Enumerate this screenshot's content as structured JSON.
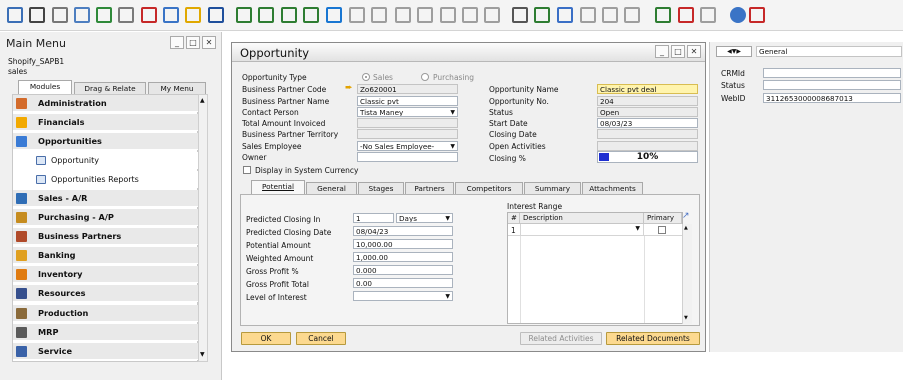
{
  "toolbar": {
    "icons": [
      "search-icon",
      "print-icon",
      "email-icon",
      "fax-icon",
      "excel-icon",
      "word-icon",
      "pdf-icon",
      "launch-icon",
      "lock-icon",
      "binoculars-icon",
      "first-record-icon",
      "previous-record-icon",
      "next-record-icon",
      "last-record-icon",
      "refresh-icon",
      "filter-icon",
      "sort-icon",
      "base-document-icon",
      "target-document-icon",
      "gross-profit-icon",
      "tree-icon",
      "layout-icon",
      "pen-icon",
      "edit-icon",
      "approve-icon",
      "message-icon",
      "chat-icon",
      "settings-icon",
      "calendar-icon",
      "cockpit-icon",
      "org-icon",
      "help-icon",
      "exit-icon"
    ]
  },
  "main_menu": {
    "title": "Main Menu",
    "company": "Shopify_SAPB1",
    "user": "sales",
    "tabs": [
      "Modules",
      "Drag & Relate",
      "My Menu"
    ],
    "items": [
      {
        "label": "Administration",
        "sub": false,
        "icon": "administration-icon"
      },
      {
        "label": "Financials",
        "sub": false,
        "icon": "financials-icon"
      },
      {
        "label": "Opportunities",
        "sub": false,
        "icon": "opportunities-icon"
      },
      {
        "label": "Opportunity",
        "sub": true,
        "icon": "folder-icon"
      },
      {
        "label": "Opportunities Reports",
        "sub": true,
        "icon": "folder-icon"
      },
      {
        "label": "Sales - A/R",
        "sub": false,
        "icon": "sales-icon"
      },
      {
        "label": "Purchasing - A/P",
        "sub": false,
        "icon": "purchasing-icon"
      },
      {
        "label": "Business Partners",
        "sub": false,
        "icon": "business-partners-icon"
      },
      {
        "label": "Banking",
        "sub": false,
        "icon": "banking-icon"
      },
      {
        "label": "Inventory",
        "sub": false,
        "icon": "inventory-icon"
      },
      {
        "label": "Resources",
        "sub": false,
        "icon": "resources-icon"
      },
      {
        "label": "Production",
        "sub": false,
        "icon": "production-icon"
      },
      {
        "label": "MRP",
        "sub": false,
        "icon": "mrp-icon"
      },
      {
        "label": "Service",
        "sub": false,
        "icon": "service-icon"
      }
    ]
  },
  "opportunity": {
    "title": "Opportunity",
    "left_labels": {
      "type": "Opportunity Type",
      "bp_code": "Business Partner Code",
      "bp_name": "Business Partner Name",
      "contact": "Contact Person",
      "total": "Total Amount Invoiced",
      "territory": "Business Partner Territory",
      "employee": "Sales Employee",
      "owner": "Owner",
      "display_sys": "Display in System Currency"
    },
    "type_options": {
      "sales": "Sales",
      "purchasing": "Purchasing"
    },
    "left_values": {
      "bp_code": "Zo620001",
      "bp_name": "Classic pvt",
      "contact": "Tista Maney",
      "total": "",
      "territory": "",
      "employee": "-No Sales Employee-",
      "owner": ""
    },
    "right_labels": {
      "name": "Opportunity Name",
      "no": "Opportunity No.",
      "status": "Status",
      "start": "Start Date",
      "closing": "Closing Date",
      "activities": "Open Activities",
      "pct": "Closing %"
    },
    "right_values": {
      "name": "Classic pvt deal",
      "no": "204",
      "status": "Open",
      "start": "08/03/23",
      "closing": "",
      "activities": "",
      "pct": "10%"
    },
    "closing_pct_fill": 0.1,
    "tabs": [
      "Potential",
      "General",
      "Stages",
      "Partners",
      "Competitors",
      "Summary",
      "Attachments"
    ],
    "potential": {
      "labels": {
        "pcl": "Predicted Closing In",
        "pcd": "Predicted Closing Date",
        "pa": "Potential Amount",
        "wa": "Weighted Amount",
        "gp": "Gross Profit %",
        "gpt": "Gross Profit Total",
        "loi": "Level of Interest"
      },
      "values": {
        "pcl": "1",
        "pcl_unit": "Days",
        "pcd": "08/04/23",
        "pa": "10,000.00",
        "wa": "1,000.00",
        "gp": "0.000",
        "gpt": "0.00",
        "loi": ""
      }
    },
    "interest_range": {
      "title": "Interest Range",
      "columns": [
        "#",
        "Description",
        "Primary"
      ],
      "rows": [
        {
          "num": "1",
          "desc": ""
        }
      ]
    },
    "buttons": {
      "ok": "OK",
      "cancel": "Cancel",
      "related_activities": "Related Activities",
      "related_documents": "Related Documents"
    }
  },
  "right_panel": {
    "dropdown": "General",
    "fields": [
      {
        "label": "CRMId",
        "value": ""
      },
      {
        "label": "Status",
        "value": ""
      },
      {
        "label": "WebID",
        "value": "3112653000008687013"
      }
    ]
  },
  "colors": {
    "accent_button": "#fcd98f",
    "highlight_field": "#fff4ad",
    "progress": "#1e2fd1"
  }
}
